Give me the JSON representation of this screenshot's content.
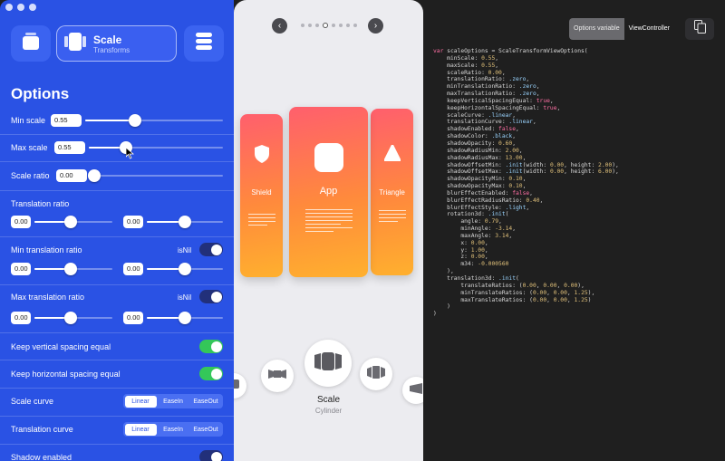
{
  "colors": {
    "accent": "#2a52e4",
    "toggle_on": "#34c759",
    "card_gradient": [
      "#ff5f6d",
      "#ff8a3c",
      "#ffb02e"
    ]
  },
  "header": {
    "selected_mode": {
      "title": "Scale",
      "subtitle": "Transforms"
    }
  },
  "options": {
    "title": "Options",
    "min_scale": {
      "label": "Min scale",
      "value": "0.55",
      "fraction": 0.55
    },
    "max_scale": {
      "label": "Max scale",
      "value": "0.55",
      "fraction": 0.55
    },
    "scale_ratio": {
      "label": "Scale ratio",
      "value": "0.00",
      "fraction": 0.0
    },
    "translation_ratio": {
      "label": "Translation ratio",
      "x": "0.00",
      "y": "0.00"
    },
    "min_translation_ratio": {
      "label": "Min translation ratio",
      "isnil": "isNil",
      "x": "0.00",
      "y": "0.00"
    },
    "max_translation_ratio": {
      "label": "Max translation ratio",
      "isnil": "isNil",
      "x": "0.00",
      "y": "0.00"
    },
    "keep_vertical": {
      "label": "Keep vertical spacing equal",
      "on": true
    },
    "keep_horizontal": {
      "label": "Keep horizontal spacing equal",
      "on": true
    },
    "scale_curve": {
      "label": "Scale curve",
      "options": [
        "Linear",
        "EaseIn",
        "EaseOut"
      ],
      "selected": "Linear"
    },
    "translation_curve": {
      "label": "Translation curve",
      "options": [
        "Linear",
        "EaseIn",
        "EaseOut"
      ],
      "selected": "Linear"
    },
    "shadow_enabled": {
      "label": "Shadow enabled",
      "on": false
    }
  },
  "preview": {
    "page_count": 8,
    "current_page": 4,
    "cards": [
      {
        "name": "Shield",
        "icon": "shield-icon"
      },
      {
        "name": "App",
        "icon": "app-icon"
      },
      {
        "name": "Triangle",
        "icon": "triangle-icon"
      }
    ],
    "selected_layout": {
      "title": "Scale",
      "subtitle": "Cylinder"
    }
  },
  "code_panel": {
    "tabs": [
      "Options variable",
      "ViewController"
    ],
    "active_tab": "Options variable",
    "lines": [
      "var scaleOptions = ScaleTransformViewOptions(",
      "    minScale: 0.55,",
      "    maxScale: 0.55,",
      "    scaleRatio: 0.00,",
      "    translationRatio: .zero,",
      "    minTranslationRatio: .zero,",
      "    maxTranslationRatio: .zero,",
      "    keepVerticalSpacingEqual: true,",
      "    keepHorizontalSpacingEqual: true,",
      "    scaleCurve: .linear,",
      "    translationCurve: .linear,",
      "    shadowEnabled: false,",
      "    shadowColor: .black,",
      "    shadowOpacity: 0.60,",
      "    shadowRadiusMin: 2.00,",
      "    shadowRadiusMax: 13.00,",
      "    shadowOffsetMin: .init(width: 0.00, height: 2.00),",
      "    shadowOffsetMax: .init(width: 0.00, height: 6.00),",
      "    shadowOpacityMin: 0.10,",
      "    shadowOpacityMax: 0.10,",
      "    blurEffectEnabled: false,",
      "    blurEffectRadiusRatio: 0.40,",
      "    blurEffectStyle: .light,",
      "    rotation3d: .init(",
      "        angle: 0.79,",
      "        minAngle: -3.14,",
      "        maxAngle: 3.14,",
      "        x: 0.00,",
      "        y: 1.00,",
      "        z: 0.00,",
      "        m34: -0.000560",
      "    ),",
      "    translation3d: .init(",
      "        translateRatios: (0.00, 0.00, 0.00),",
      "        minTranslateRatios: (0.00, 0.00, 1.25),",
      "        maxTranslateRatios: (0.00, 0.00, 1.25)",
      "    )",
      ")"
    ]
  }
}
